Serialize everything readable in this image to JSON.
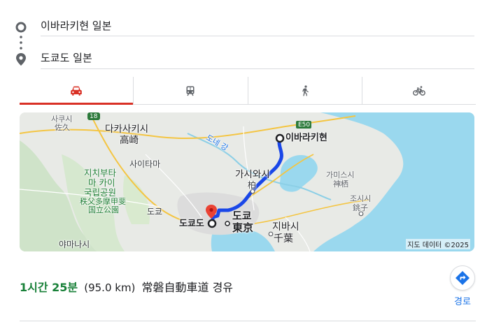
{
  "directions": {
    "origin": "이바라키현 일본",
    "destination": "도쿄도 일본"
  },
  "travel_modes": [
    {
      "mode": "driving",
      "icon": "car-icon",
      "active": true
    },
    {
      "mode": "transit",
      "icon": "train-icon",
      "active": false
    },
    {
      "mode": "walking",
      "icon": "walk-icon",
      "active": false
    },
    {
      "mode": "cycling",
      "icon": "bike-icon",
      "active": false
    }
  ],
  "map": {
    "labels": {
      "sakushi": "사쿠시",
      "saku": "佐久",
      "takasaki_ko": "다카사키시",
      "takasaki": "高崎",
      "saitama": "사이타마",
      "tone": "도네 강",
      "chichibu1": "지치부타",
      "chichibu2": "마 카이",
      "chichibu3": "국립공원",
      "chichibu_jp1": "秩父多摩甲斐",
      "chichibu_jp2": "国立公園",
      "tokyo_pref": "도쿄",
      "kashiwa_ko": "가시와시",
      "kashiwa": "柏",
      "kamisu_ko": "가미스시",
      "kamisu": "神栖",
      "choshi_ko": "조시시",
      "choshi": "銚子",
      "ibaraki": "이바라키현",
      "tokyo_ko": "도쿄",
      "tokyo_jp": "東京",
      "tokyo_dest": "도쿄도",
      "chiba_ko": "지바시",
      "chiba_jp": "千葉",
      "yamanashi": "야마나시",
      "highway_e50": "E50",
      "highway_18": "18"
    },
    "attribution": "지도 데이터 ©2025",
    "colors": {
      "route": "#1a47e8",
      "water": "#9ad8ee",
      "land": "#e8eae6",
      "pin": "#ea4335"
    }
  },
  "route": {
    "duration": "1시간 25분",
    "distance": "(95.0 km)",
    "via": "常磐自動車道 경유",
    "directions_label": "경로"
  }
}
